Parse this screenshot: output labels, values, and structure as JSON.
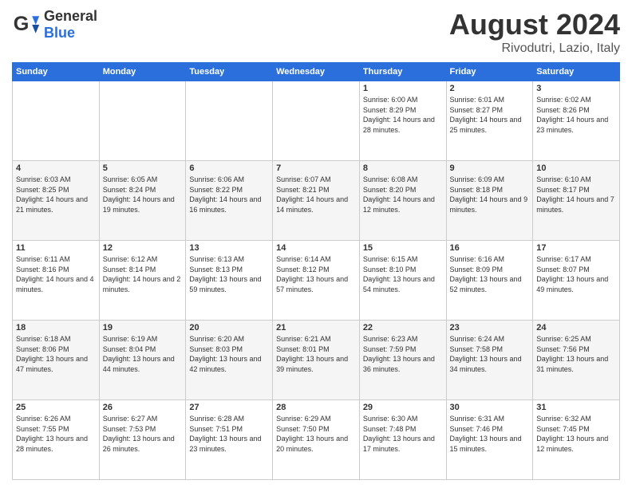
{
  "header": {
    "logo_general": "General",
    "logo_blue": "Blue",
    "main_title": "August 2024",
    "sub_title": "Rivodutri, Lazio, Italy"
  },
  "weekdays": [
    "Sunday",
    "Monday",
    "Tuesday",
    "Wednesday",
    "Thursday",
    "Friday",
    "Saturday"
  ],
  "weeks": [
    [
      {
        "day": "",
        "info": ""
      },
      {
        "day": "",
        "info": ""
      },
      {
        "day": "",
        "info": ""
      },
      {
        "day": "",
        "info": ""
      },
      {
        "day": "1",
        "info": "Sunrise: 6:00 AM\nSunset: 8:29 PM\nDaylight: 14 hours\nand 28 minutes."
      },
      {
        "day": "2",
        "info": "Sunrise: 6:01 AM\nSunset: 8:27 PM\nDaylight: 14 hours\nand 25 minutes."
      },
      {
        "day": "3",
        "info": "Sunrise: 6:02 AM\nSunset: 8:26 PM\nDaylight: 14 hours\nand 23 minutes."
      }
    ],
    [
      {
        "day": "4",
        "info": "Sunrise: 6:03 AM\nSunset: 8:25 PM\nDaylight: 14 hours\nand 21 minutes."
      },
      {
        "day": "5",
        "info": "Sunrise: 6:05 AM\nSunset: 8:24 PM\nDaylight: 14 hours\nand 19 minutes."
      },
      {
        "day": "6",
        "info": "Sunrise: 6:06 AM\nSunset: 8:22 PM\nDaylight: 14 hours\nand 16 minutes."
      },
      {
        "day": "7",
        "info": "Sunrise: 6:07 AM\nSunset: 8:21 PM\nDaylight: 14 hours\nand 14 minutes."
      },
      {
        "day": "8",
        "info": "Sunrise: 6:08 AM\nSunset: 8:20 PM\nDaylight: 14 hours\nand 12 minutes."
      },
      {
        "day": "9",
        "info": "Sunrise: 6:09 AM\nSunset: 8:18 PM\nDaylight: 14 hours\nand 9 minutes."
      },
      {
        "day": "10",
        "info": "Sunrise: 6:10 AM\nSunset: 8:17 PM\nDaylight: 14 hours\nand 7 minutes."
      }
    ],
    [
      {
        "day": "11",
        "info": "Sunrise: 6:11 AM\nSunset: 8:16 PM\nDaylight: 14 hours\nand 4 minutes."
      },
      {
        "day": "12",
        "info": "Sunrise: 6:12 AM\nSunset: 8:14 PM\nDaylight: 14 hours\nand 2 minutes."
      },
      {
        "day": "13",
        "info": "Sunrise: 6:13 AM\nSunset: 8:13 PM\nDaylight: 13 hours\nand 59 minutes."
      },
      {
        "day": "14",
        "info": "Sunrise: 6:14 AM\nSunset: 8:12 PM\nDaylight: 13 hours\nand 57 minutes."
      },
      {
        "day": "15",
        "info": "Sunrise: 6:15 AM\nSunset: 8:10 PM\nDaylight: 13 hours\nand 54 minutes."
      },
      {
        "day": "16",
        "info": "Sunrise: 6:16 AM\nSunset: 8:09 PM\nDaylight: 13 hours\nand 52 minutes."
      },
      {
        "day": "17",
        "info": "Sunrise: 6:17 AM\nSunset: 8:07 PM\nDaylight: 13 hours\nand 49 minutes."
      }
    ],
    [
      {
        "day": "18",
        "info": "Sunrise: 6:18 AM\nSunset: 8:06 PM\nDaylight: 13 hours\nand 47 minutes."
      },
      {
        "day": "19",
        "info": "Sunrise: 6:19 AM\nSunset: 8:04 PM\nDaylight: 13 hours\nand 44 minutes."
      },
      {
        "day": "20",
        "info": "Sunrise: 6:20 AM\nSunset: 8:03 PM\nDaylight: 13 hours\nand 42 minutes."
      },
      {
        "day": "21",
        "info": "Sunrise: 6:21 AM\nSunset: 8:01 PM\nDaylight: 13 hours\nand 39 minutes."
      },
      {
        "day": "22",
        "info": "Sunrise: 6:23 AM\nSunset: 7:59 PM\nDaylight: 13 hours\nand 36 minutes."
      },
      {
        "day": "23",
        "info": "Sunrise: 6:24 AM\nSunset: 7:58 PM\nDaylight: 13 hours\nand 34 minutes."
      },
      {
        "day": "24",
        "info": "Sunrise: 6:25 AM\nSunset: 7:56 PM\nDaylight: 13 hours\nand 31 minutes."
      }
    ],
    [
      {
        "day": "25",
        "info": "Sunrise: 6:26 AM\nSunset: 7:55 PM\nDaylight: 13 hours\nand 28 minutes."
      },
      {
        "day": "26",
        "info": "Sunrise: 6:27 AM\nSunset: 7:53 PM\nDaylight: 13 hours\nand 26 minutes."
      },
      {
        "day": "27",
        "info": "Sunrise: 6:28 AM\nSunset: 7:51 PM\nDaylight: 13 hours\nand 23 minutes."
      },
      {
        "day": "28",
        "info": "Sunrise: 6:29 AM\nSunset: 7:50 PM\nDaylight: 13 hours\nand 20 minutes."
      },
      {
        "day": "29",
        "info": "Sunrise: 6:30 AM\nSunset: 7:48 PM\nDaylight: 13 hours\nand 17 minutes."
      },
      {
        "day": "30",
        "info": "Sunrise: 6:31 AM\nSunset: 7:46 PM\nDaylight: 13 hours\nand 15 minutes."
      },
      {
        "day": "31",
        "info": "Sunrise: 6:32 AM\nSunset: 7:45 PM\nDaylight: 13 hours\nand 12 minutes."
      }
    ]
  ]
}
